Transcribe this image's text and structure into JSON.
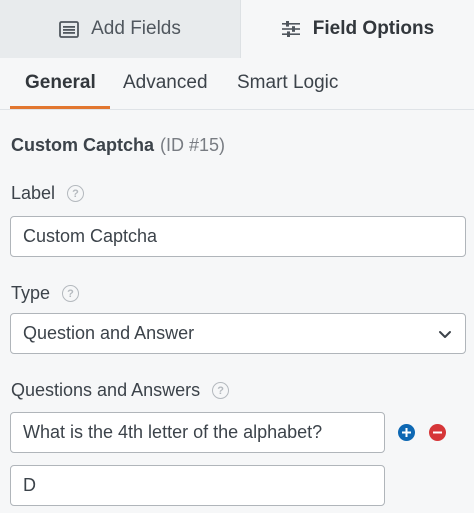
{
  "top_tabs": {
    "add_fields": "Add Fields",
    "field_options": "Field Options"
  },
  "sub_tabs": {
    "general": "General",
    "advanced": "Advanced",
    "smart_logic": "Smart Logic",
    "active": "General",
    "accent_color": "#e27730"
  },
  "field": {
    "name": "Custom Captcha",
    "id_text": "(ID #15)"
  },
  "label_section": {
    "label": "Label",
    "value": "Custom Captcha"
  },
  "type_section": {
    "label": "Type",
    "selected": "Question and Answer"
  },
  "qa_section": {
    "label": "Questions and Answers",
    "question": "What is the 4th letter of the alphabet?",
    "answer": "D",
    "add_color": "#0e68b3",
    "remove_color": "#d63638"
  },
  "icons": {
    "help": "?",
    "add": "plus-circle-icon",
    "remove": "minus-circle-icon"
  }
}
